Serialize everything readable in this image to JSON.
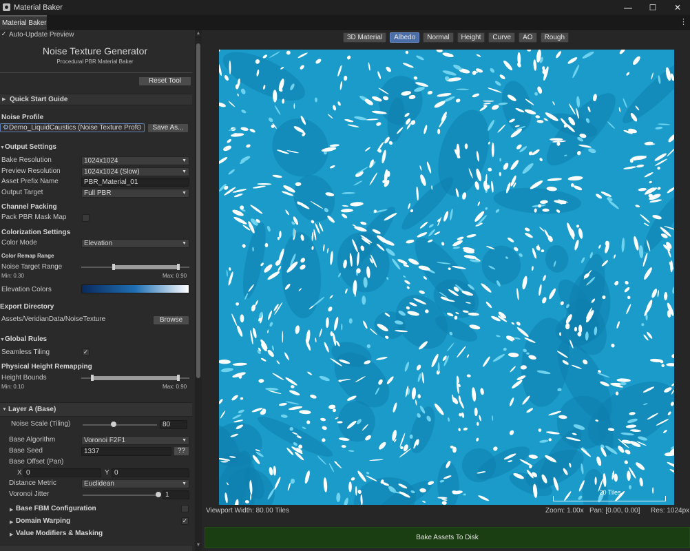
{
  "window": {
    "title": "Material Baker",
    "minimize": "—",
    "maximize": "☐",
    "close": "✕"
  },
  "tab": {
    "label": "Material Baker",
    "menu": "⋮"
  },
  "panel": {
    "auto_update": "Auto-Update Preview",
    "auto_update_check": "✓",
    "title": "Noise Texture Generator",
    "subtitle": "Procedural PBR Material Baker",
    "reset": "Reset Tool",
    "quick_start": "Quick Start Guide",
    "noise_profile_header": "Noise Profile",
    "profile_value": "Demo_LiquidCaustics (Noise Texture Prof",
    "save_as": "Save As...",
    "output_settings": "Output Settings",
    "bake_res_label": "Bake Resolution",
    "bake_res_value": "1024x1024",
    "preview_res_label": "Preview Resolution",
    "preview_res_value": "1024x1024 (Slow)",
    "asset_prefix_label": "Asset Prefix Name",
    "asset_prefix_value": "PBR_Material_01",
    "output_target_label": "Output Target",
    "output_target_value": "Full PBR",
    "channel_packing": "Channel Packing",
    "pack_mask_label": "Pack PBR Mask Map",
    "colorization": "Colorization Settings",
    "color_mode_label": "Color Mode",
    "color_mode_value": "Elevation",
    "color_remap_range": "Color Remap Range",
    "noise_target_label": "Noise Target Range",
    "noise_min": "Min: 0.30",
    "noise_max": "Max: 0.90",
    "noise_range": [
      0.3,
      0.9
    ],
    "elevation_colors_label": "Elevation Colors",
    "elevation_gradient": [
      "#0a2a5c",
      "#1f6fb4",
      "#ffffff"
    ],
    "export_dir": "Export Directory",
    "export_path": "Assets/VeridianData/NoiseTexture",
    "browse": "Browse",
    "global_rules": "Global Rules",
    "seamless_label": "Seamless Tiling",
    "seamless_check": "✓",
    "phys_height": "Physical Height Remapping",
    "height_bounds_label": "Height Bounds",
    "height_min": "Min: 0.10",
    "height_max": "Max: 0.90",
    "height_range": [
      0.1,
      0.9
    ],
    "layer_a": "Layer A (Base)",
    "noise_scale_label": "Noise Scale (Tiling)",
    "noise_scale_value": "80",
    "noise_scale_fraction": 0.42,
    "base_algo_label": "Base Algorithm",
    "base_algo_value": "Voronoi F2F1",
    "base_seed_label": "Base Seed",
    "base_seed_value": "1337",
    "seed_random": "??",
    "base_offset_label": "Base Offset (Pan)",
    "x_label": "X",
    "x_value": "0",
    "y_label": "Y",
    "y_value": "0",
    "distance_label": "Distance Metric",
    "distance_value": "Euclidean",
    "jitter_label": "Voronoi Jitter",
    "jitter_value": "1",
    "jitter_fraction": 1.0,
    "fbm": "Base FBM Configuration",
    "domain_warping": "Domain Warping",
    "domain_warping_check": "✓",
    "value_modifiers": "Value Modifiers & Masking"
  },
  "viewport": {
    "modes": [
      {
        "label": "3D Material",
        "active": false
      },
      {
        "label": "Albedo",
        "active": true
      },
      {
        "label": "Normal",
        "active": false
      },
      {
        "label": "Height",
        "active": false
      },
      {
        "label": "Curve",
        "active": false
      },
      {
        "label": "AO",
        "active": false
      },
      {
        "label": "Rough",
        "active": false
      }
    ],
    "scale_label": "20 Tiles",
    "width_text": "Viewport Width: 80.00 Tiles",
    "zoom_text": "Zoom: 1.00x",
    "pan_text": "Pan: [0.00, 0.00]",
    "res_text": "Res: 1024px",
    "bake_button": "Bake Assets To Disk",
    "texture_colors": [
      "#1a9bc9",
      "#0f7fae",
      "#ffffff",
      "#6fd3ef"
    ]
  }
}
